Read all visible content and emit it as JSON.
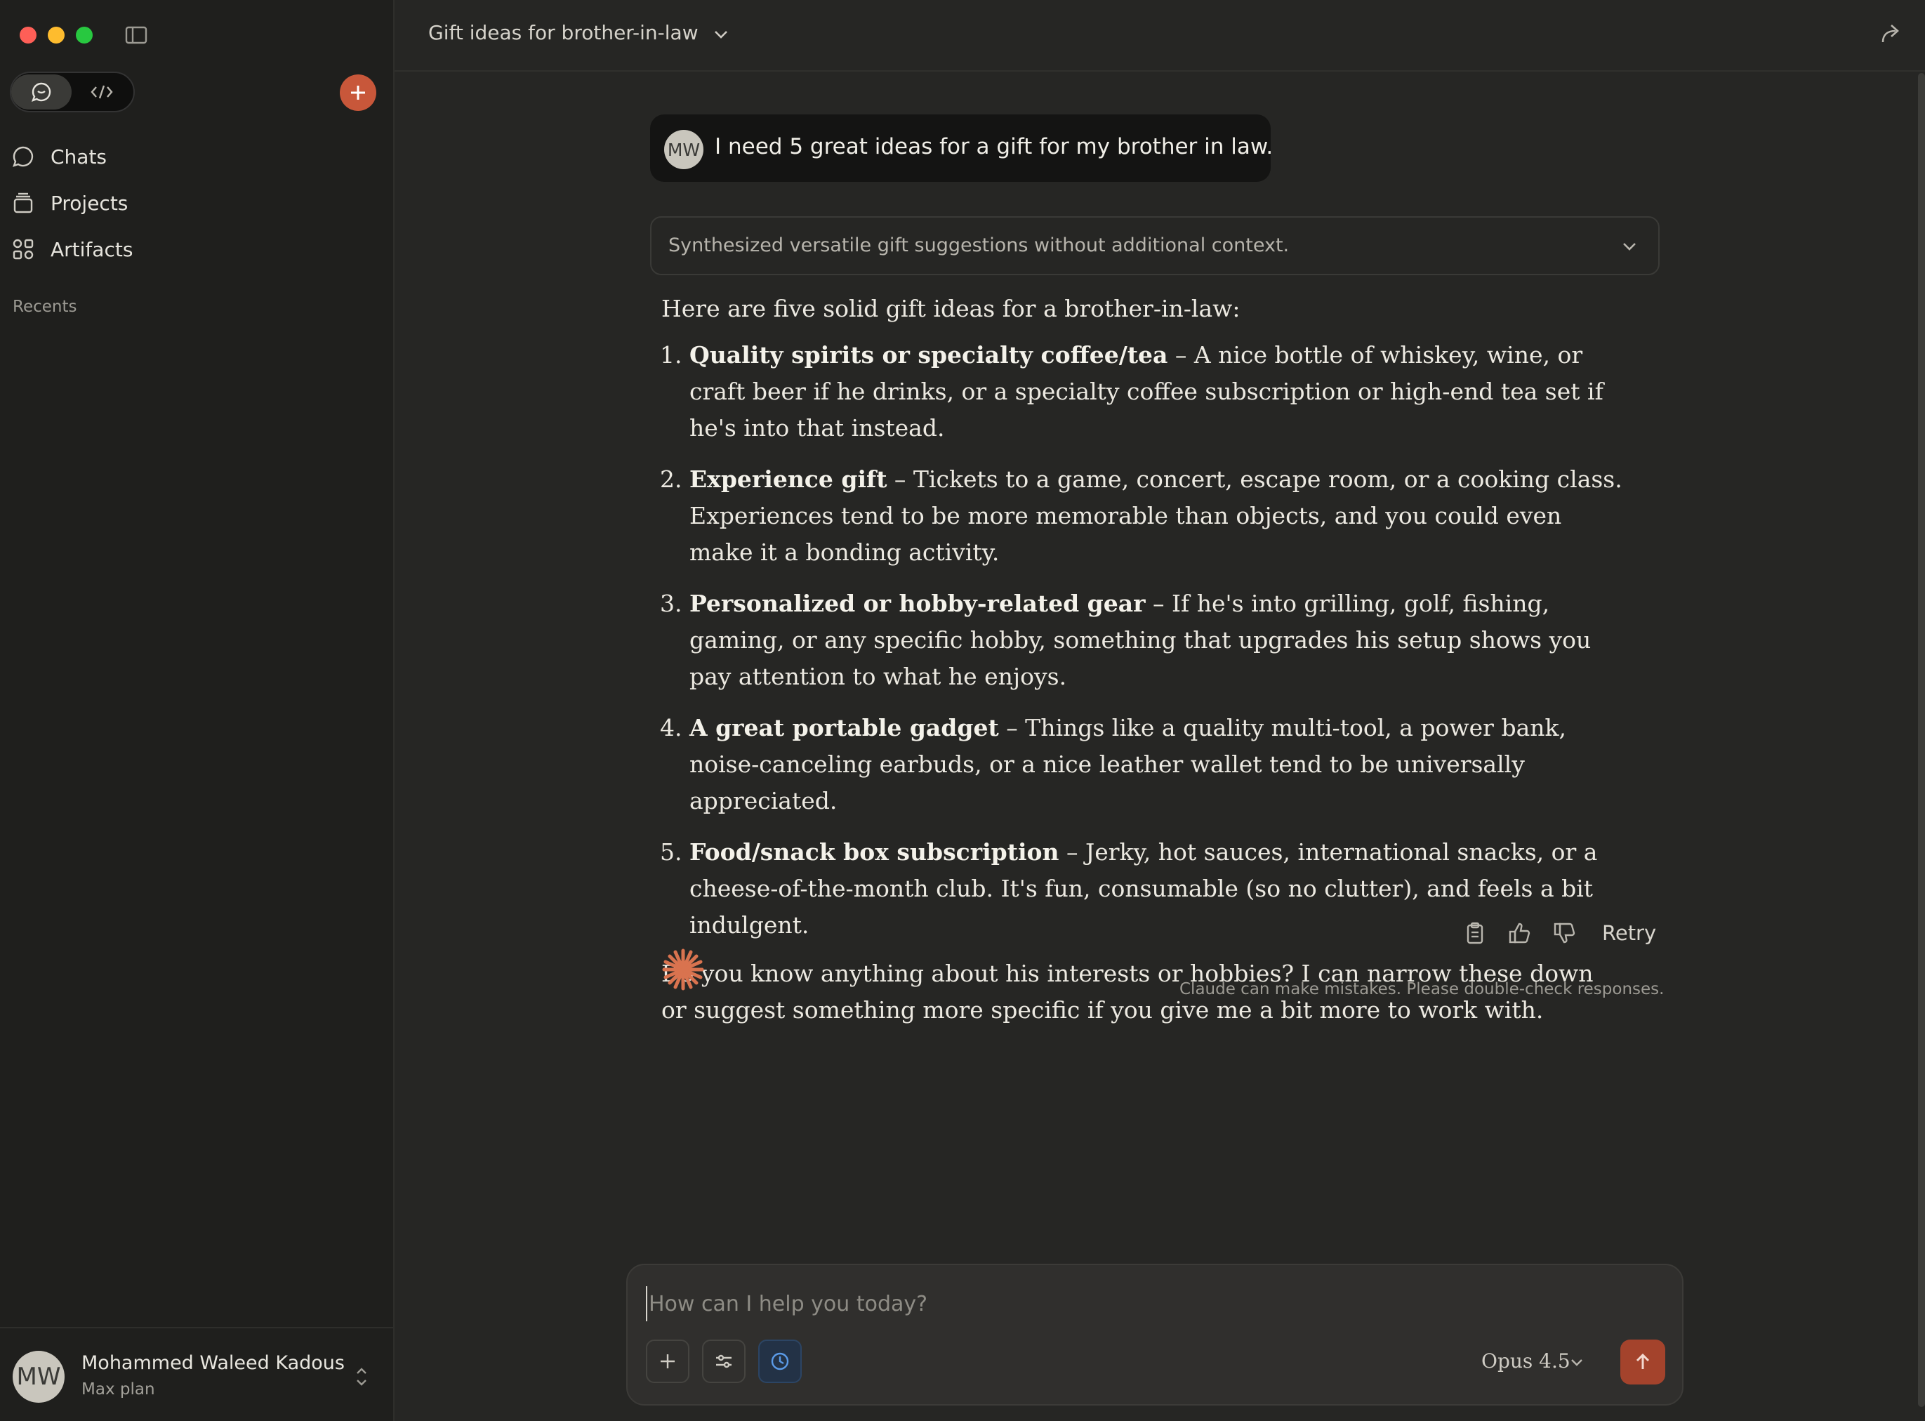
{
  "sidebar": {
    "nav": [
      {
        "label": "Chats",
        "icon": "chat-bubble-icon"
      },
      {
        "label": "Projects",
        "icon": "folder-stack-icon"
      },
      {
        "label": "Artifacts",
        "icon": "artifacts-grid-icon"
      }
    ],
    "recents_label": "Recents",
    "user": {
      "initials": "MW",
      "name": "Mohammed Waleed Kadous",
      "plan": "Max plan"
    }
  },
  "header": {
    "title": "Gift ideas for brother-in-law"
  },
  "conversation": {
    "user_message": {
      "initials": "MW",
      "text": "I need 5 great ideas for a gift for my brother in law."
    },
    "thinking_summary": "Synthesized versatile gift suggestions without additional context.",
    "response": {
      "intro": "Here are five solid gift ideas for a brother-in-law:",
      "items": [
        {
          "title": "Quality spirits or specialty coffee/tea",
          "text": " – A nice bottle of whiskey, wine, or craft beer if he drinks, or a specialty coffee subscription or high-end tea set if he's into that instead."
        },
        {
          "title": "Experience gift",
          "text": " – Tickets to a game, concert, escape room, or a cooking class. Experiences tend to be more memorable than objects, and you could even make it a bonding activity."
        },
        {
          "title": "Personalized or hobby-related gear",
          "text": " – If he's into grilling, golf, fishing, gaming, or any specific hobby, something that upgrades his setup shows you pay attention to what he enjoys."
        },
        {
          "title": "A great portable gadget",
          "text": " – Things like a quality multi-tool, a power bank, noise-canceling earbuds, or a nice leather wallet tend to be universally appreciated."
        },
        {
          "title": "Food/snack box subscription",
          "text": " – Jerky, hot sauces, international snacks, or a cheese-of-the-month club. It's fun, consumable (so no clutter), and feels a bit indulgent."
        }
      ],
      "outro": "Do you know anything about his interests or hobbies? I can narrow these down or suggest something more specific if you give me a bit more to work with."
    },
    "actions": {
      "retry_label": "Retry"
    },
    "disclaimer": "Claude can make mistakes. Please double-check responses."
  },
  "composer": {
    "placeholder": "How can I help you today?",
    "value": "",
    "model": "Opus 4.5"
  },
  "colors": {
    "accent": "#c8573a",
    "send_button": "#a4432c",
    "background": "#262624",
    "sidebar": "#1f1f1d",
    "active_tool": "#233246"
  }
}
